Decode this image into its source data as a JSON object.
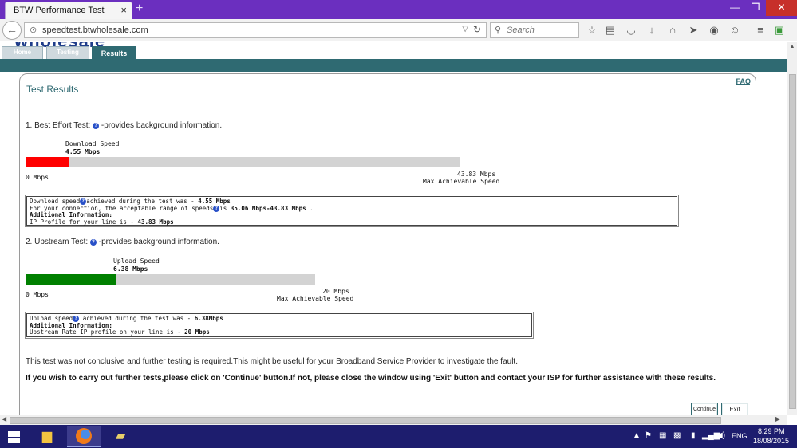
{
  "browser": {
    "tab_title": "BTW Performance Test",
    "tab_close": "×",
    "new_tab": "+",
    "url": "speedtest.btwholesale.com",
    "search_placeholder": "Search",
    "window_buttons": {
      "minimize": "—",
      "maximize": "❐",
      "close": "✕"
    },
    "toolbar_icons": [
      "bookmark-star-icon",
      "reading-list-icon",
      "pocket-icon",
      "download-icon",
      "home-icon",
      "send-icon",
      "sync-icon",
      "emoji-icon",
      "menu-icon",
      "extension-icon"
    ]
  },
  "site": {
    "logo_fragment": "wholesale",
    "nav": {
      "home": "Home",
      "testing": "Testing",
      "results": "Results"
    },
    "faq": "FAQ"
  },
  "results": {
    "title": "Test Results",
    "best_effort": {
      "heading_pre": "1. Best Effort Test:",
      "heading_post": "-provides background information.",
      "metric_label": "Download Speed",
      "metric_value": "4.55 Mbps",
      "zero_label": "0 Mbps",
      "max_value": "43.83 Mbps",
      "max_label": "Max Achievable Speed",
      "fill_fraction": 0.1,
      "bar_color": "#ff0000",
      "info": {
        "line1_a": "Download speed",
        "line1_b": "achieved during the test was - ",
        "line1_c": "4.55 Mbps",
        "line2_a": "For your connection, the acceptable range of speeds",
        "line2_b": "is ",
        "line2_c": "35.06 Mbps-43.83 Mbps",
        "line2_d": " .",
        "line3": "Additional Information:",
        "line4_a": "IP Profile for your line is - ",
        "line4_b": "43.83 Mbps"
      }
    },
    "upstream": {
      "heading_pre": "2. Upstream Test:",
      "heading_post": "-provides background information.",
      "metric_label": "Upload Speed",
      "metric_value": "6.38 Mbps",
      "zero_label": "0 Mbps",
      "max_value": "20 Mbps",
      "max_label": "Max Achievable Speed",
      "fill_fraction": 0.31,
      "bar_color": "#008000",
      "info": {
        "line1_a": "Upload speed",
        "line1_b": " achieved during the test was - ",
        "line1_c": "6.38Mbps",
        "line2": "Additional Information:",
        "line3_a": "Upstream Rate IP profile on your line is - ",
        "line3_b": "20 Mbps"
      }
    },
    "conclusion": "This test was not conclusive and further testing is required.This might be useful for your Broadband Service Provider to investigate the fault.",
    "instruction": "If you wish to carry out further tests,please click on 'Continue' button.If not, please close the window using 'Exit' button and contact your ISP for further assistance with these results.",
    "continue_button": "Continue",
    "exit_button": "Exit"
  },
  "taskbar": {
    "language": "ENG",
    "time": "8:29 PM",
    "date": "18/08/2015"
  },
  "colors": {
    "accent_teal": "#2f6a72",
    "download_bar": "#ff0000",
    "upload_bar": "#008000",
    "titlebar": "#6b2fbf",
    "taskbar": "#1d1d6e"
  }
}
